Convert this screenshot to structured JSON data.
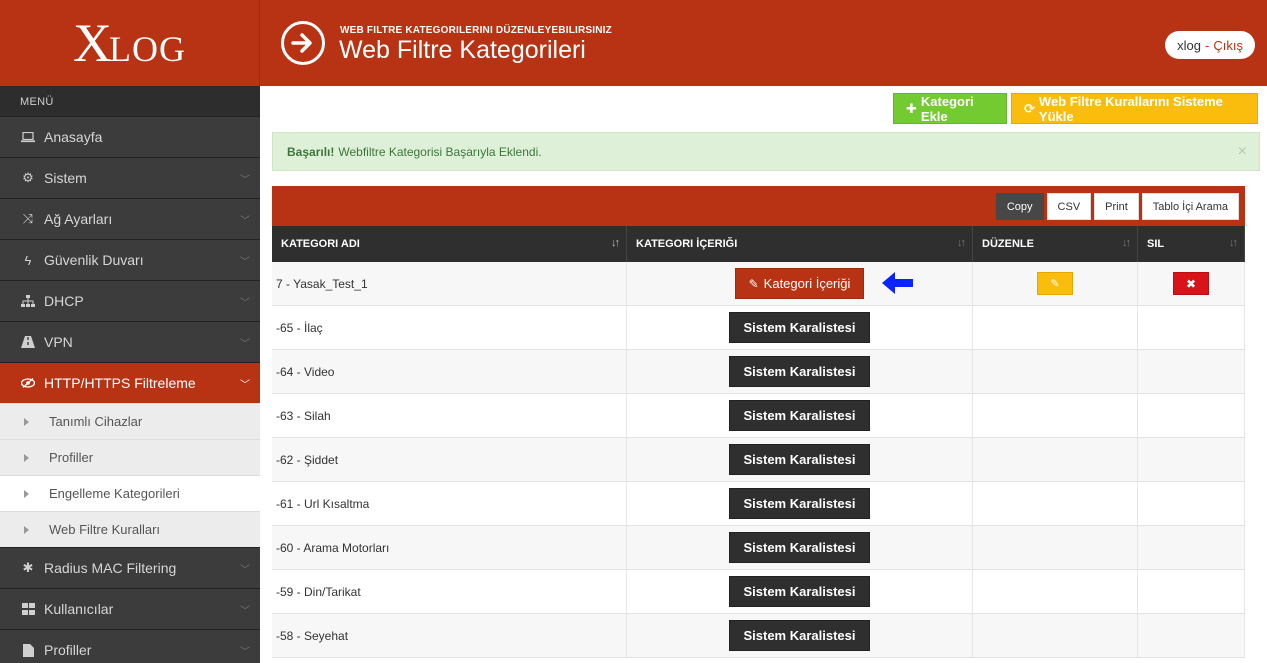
{
  "brand": {
    "logo_x": "X",
    "logo_rest": "LOG"
  },
  "header": {
    "subtitle": "WEB FILTRE KATEGORILERINI DÜZENLEYEBILIRSINIZ",
    "title": "Web Filtre Kategorileri",
    "user": "xlog",
    "separator": "-",
    "logout": "Çıkış"
  },
  "sidebar": {
    "heading": "MENÜ",
    "items": [
      {
        "label": "Anasayfa",
        "icon": "laptop-icon"
      },
      {
        "label": "Sistem",
        "icon": "gears-icon"
      },
      {
        "label": "Ağ Ayarları",
        "icon": "shuffle-icon"
      },
      {
        "label": "Güvenlik Duvarı",
        "icon": "bolt-icon"
      },
      {
        "label": "DHCP",
        "icon": "sitemap-icon"
      },
      {
        "label": "VPN",
        "icon": "road-icon"
      },
      {
        "label": "HTTP/HTTPS Filtreleme",
        "icon": "eye-slash-icon"
      }
    ],
    "subitems": [
      {
        "label": "Tanımlı Cihazlar"
      },
      {
        "label": "Profiller"
      },
      {
        "label": "Engelleme Kategorileri"
      },
      {
        "label": "Web Filtre Kuralları"
      }
    ],
    "items_after": [
      {
        "label": "Radius MAC Filtering",
        "icon": "asterisk-icon"
      },
      {
        "label": "Kullanıcılar",
        "icon": "grid-icon"
      },
      {
        "label": "Profiller",
        "icon": "file-icon"
      }
    ]
  },
  "toolbar": {
    "add_label": "Kategori Ekle",
    "load_label": "Web Filtre Kurallarını Sisteme Yükle"
  },
  "alert": {
    "strong": "Başarılı!",
    "message": "Webfiltre Kategorisi Başarıyla Eklendi.",
    "close": "×"
  },
  "table": {
    "export_buttons": [
      "Copy",
      "CSV",
      "Print",
      "Tablo İçi Arama"
    ],
    "columns": [
      "KATEGORI ADI",
      "KATEGORI İÇERIĞI",
      "DÜZENLE",
      "SIL"
    ],
    "rows": [
      {
        "name": "7 - Yasak_Test_1",
        "content": "Kategori İçeriği"
      },
      {
        "name": "-65 - İlaç",
        "content": "Sistem Karalistesi"
      },
      {
        "name": "-64 - Video",
        "content": "Sistem Karalistesi"
      },
      {
        "name": "-63 - Silah",
        "content": "Sistem Karalistesi"
      },
      {
        "name": "-62 - Şiddet",
        "content": "Sistem Karalistesi"
      },
      {
        "name": "-61 - Url Kısaltma",
        "content": "Sistem Karalistesi"
      },
      {
        "name": "-60 - Arama Motorları",
        "content": "Sistem Karalistesi"
      },
      {
        "name": "-59 - Din/Tarikat",
        "content": "Sistem Karalistesi"
      },
      {
        "name": "-58 - Seyehat",
        "content": "Sistem Karalistesi"
      }
    ]
  },
  "colors": {
    "brand_red": "#b83214",
    "sidebar_dark": "#3c3c3c",
    "success_green": "#74ca31",
    "warning_yellow": "#fbbd0d",
    "danger_red": "#d9131a",
    "annotation_arrow": "#0b24fb"
  }
}
